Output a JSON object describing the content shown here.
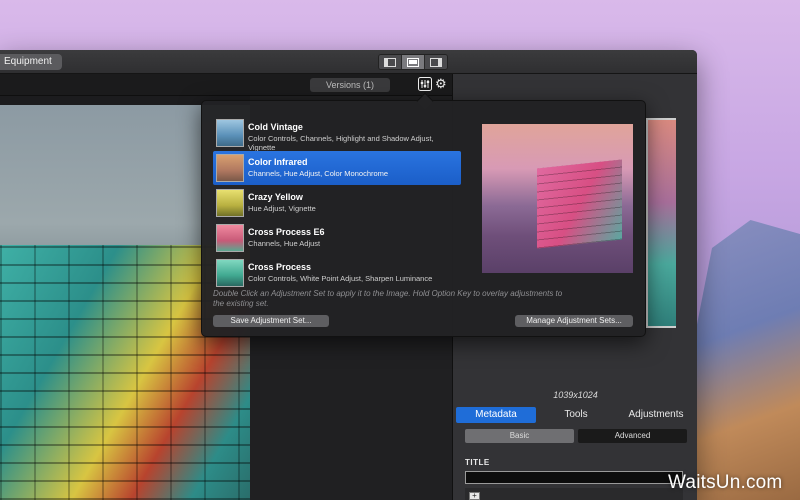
{
  "window": {
    "tag_button": "Equipment",
    "versions_label": "Versions (1)"
  },
  "inspector": {
    "dimensions": "1039x1024",
    "tabs": [
      "Metadata",
      "Tools",
      "Adjustments"
    ],
    "subtabs": [
      "Basic",
      "Advanced"
    ],
    "title_label": "TITLE",
    "zoom_plus": "+",
    "zoom_minus": "−"
  },
  "popover": {
    "presets": [
      {
        "name": "Cold Vintage",
        "desc": "Color Controls, Channels, Highlight and Shadow Adjust, Vignette",
        "selected": false,
        "swatch_color": "#6aa6d0"
      },
      {
        "name": "Color Infrared",
        "desc": "Channels, Hue Adjust, Color Monochrome",
        "selected": true,
        "swatch_color": "#b89060"
      },
      {
        "name": "Crazy Yellow",
        "desc": "Hue Adjust, Vignette",
        "selected": false,
        "swatch_color": "#c8c040"
      },
      {
        "name": "Cross Process E6",
        "desc": "Channels, Hue Adjust",
        "selected": false,
        "swatch_color": "#d86a80"
      },
      {
        "name": "Cross Process",
        "desc": "Color Controls, White Point Adjust, Sharpen Luminance",
        "selected": false,
        "swatch_color": "#4ab0a0"
      }
    ],
    "hint": "Double Click an Adjustment Set to apply it to the Image. Hold Option Key to overlay adjustments to the existing set.",
    "save_button": "Save Adjustment Set...",
    "manage_button": "Manage Adjustment Sets..."
  },
  "watermark": "WaitsUn.com",
  "colors": {
    "accent": "#1f6dd8",
    "selection": "#2a74e0"
  }
}
